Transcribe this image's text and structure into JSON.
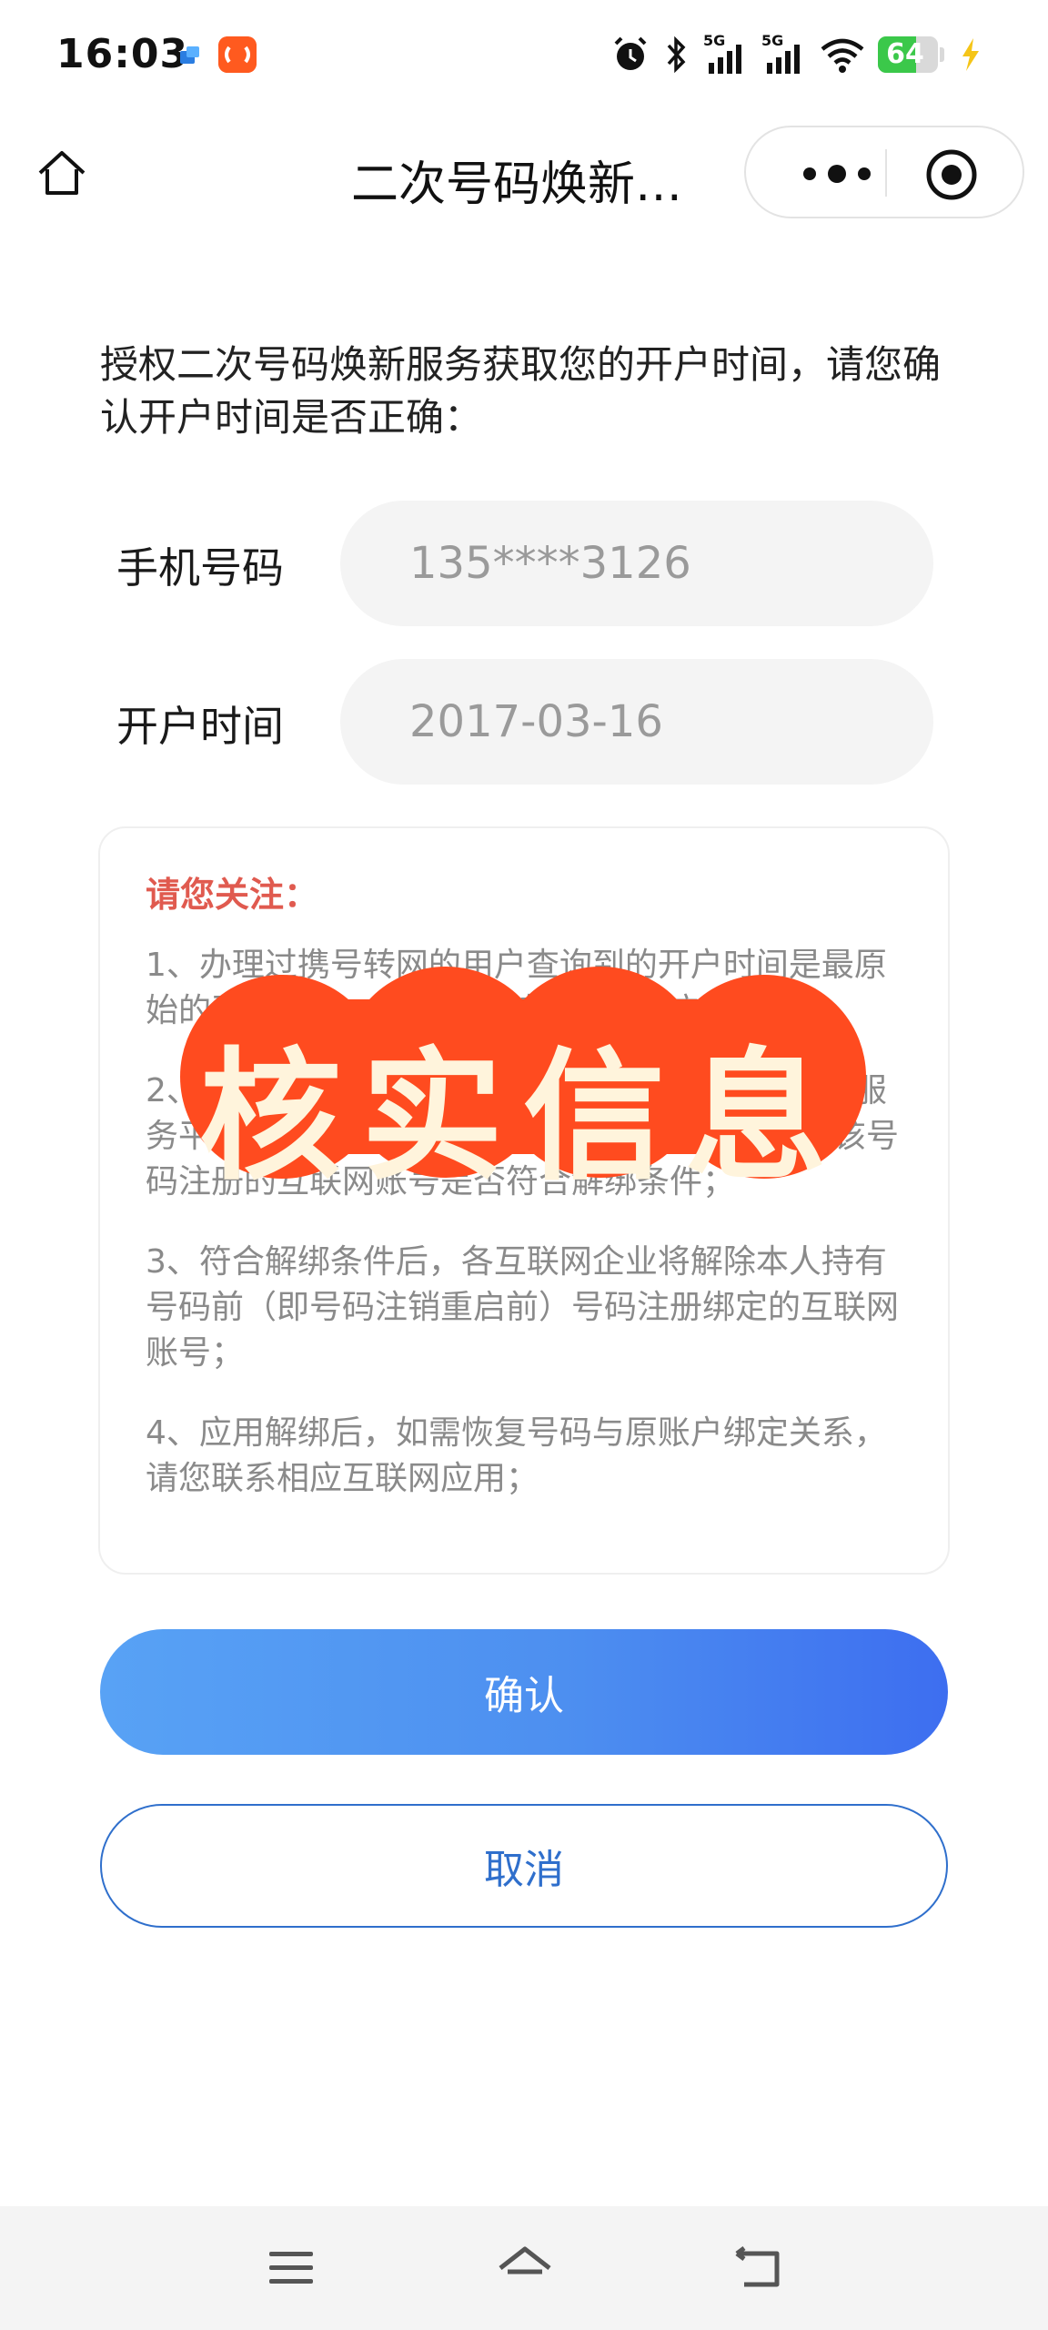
{
  "status_bar": {
    "time": "16:03",
    "signal_1": "5G",
    "signal_2": "5G",
    "battery_level": "64",
    "battery_fraction": 0.64
  },
  "nav": {
    "title": "二次号码焕新…"
  },
  "intro_text": "授权二次号码焕新服务获取您的开户时间，请您确认开户时间是否正确：",
  "fields": {
    "phone": {
      "label": "手机号码",
      "value": "135****3126"
    },
    "open_date": {
      "label": "开户时间",
      "value": "2017-03-16"
    }
  },
  "notice": {
    "title": "请您关注：",
    "items": [
      "1、办理过携号转网的用户查询到的开户时间是最原始的开户时间，不是携号转网后的开户时间；",
      "2、授权后，本服务将您的开户时间传递给互联网服务平台，各互联网企业将根据您的开户时间判断该号码注册的互联网账号是否符合解绑条件；",
      "3、符合解绑条件后，各互联网企业将解除本人持有号码前（即号码注销重启前）号码注册绑定的互联网账号；",
      "4、应用解绑后，如需恢复号码与原账户绑定关系，请您联系相应互联网应用；"
    ]
  },
  "stamp": {
    "text": "核实信息",
    "color": "#ff4b1f"
  },
  "buttons": {
    "confirm": "确认",
    "cancel": "取消"
  },
  "colors": {
    "primary": "#3d6ef0",
    "notice_title": "#e05a4f",
    "battery": "#3bc84a"
  }
}
